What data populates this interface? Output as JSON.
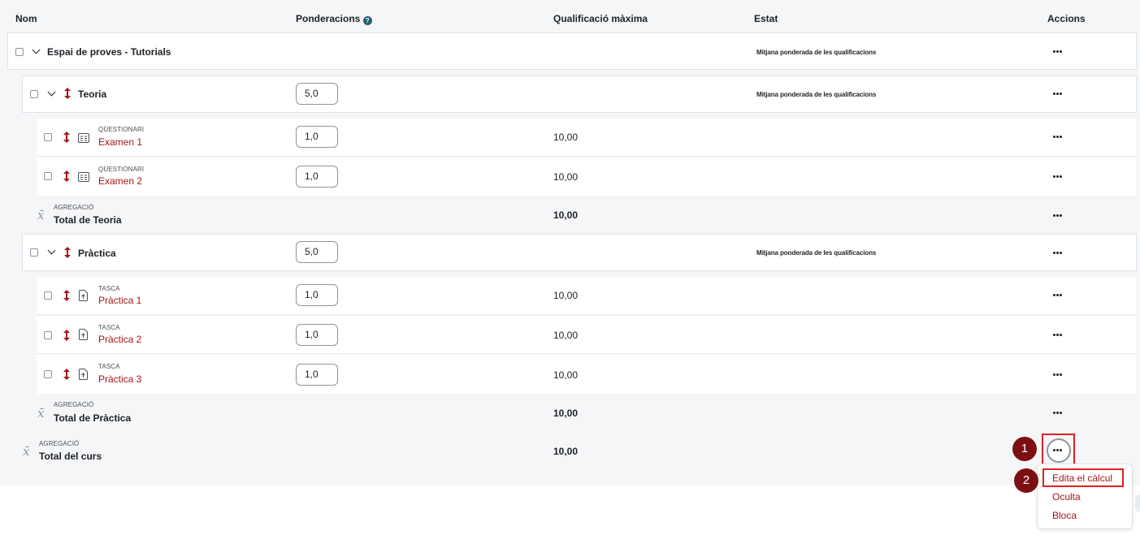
{
  "header": {
    "nom": "Nom",
    "ponderacions": "Ponderacions",
    "qualificacio_maxima": "Qualificació màxima",
    "estat": "Estat",
    "accions": "Accions"
  },
  "course": {
    "name": "Espai de proves - Tutorials",
    "estat": "Mitjana ponderada de les qualificacions"
  },
  "categories": [
    {
      "name": "Teoria",
      "weight": "5,0",
      "estat": "Mitjana ponderada de les qualificacions",
      "items": [
        {
          "type": "QÜESTIONARI",
          "name": "Examen 1",
          "weight": "1,0",
          "max": "10,00"
        },
        {
          "type": "QÜESTIONARI",
          "name": "Examen 2",
          "weight": "1,0",
          "max": "10,00"
        }
      ],
      "total_type": "AGREGACIÓ",
      "total_name": "Total de Teoria",
      "total_max": "10,00"
    },
    {
      "name": "Pràctica",
      "weight": "5,0",
      "estat": "Mitjana ponderada de les qualificacions",
      "items": [
        {
          "type": "TASCA",
          "name": "Pràctica 1",
          "weight": "1,0",
          "max": "10,00"
        },
        {
          "type": "TASCA",
          "name": "Pràctica 2",
          "weight": "1,0",
          "max": "10,00"
        },
        {
          "type": "TASCA",
          "name": "Pràctica 3",
          "weight": "1,0",
          "max": "10,00"
        }
      ],
      "total_type": "AGREGACIÓ",
      "total_name": "Total de Pràctica",
      "total_max": "10,00"
    }
  ],
  "course_total": {
    "type": "AGREGACIÓ",
    "name": "Total del curs",
    "max": "10,00"
  },
  "menu": {
    "items": [
      "Edita el càlcul",
      "Oculta",
      "Bloca"
    ]
  },
  "markers": [
    "1",
    "2"
  ],
  "colors": {
    "accent": "#a5161a",
    "marker": "#7d0f12",
    "highlight": "#e02020"
  }
}
